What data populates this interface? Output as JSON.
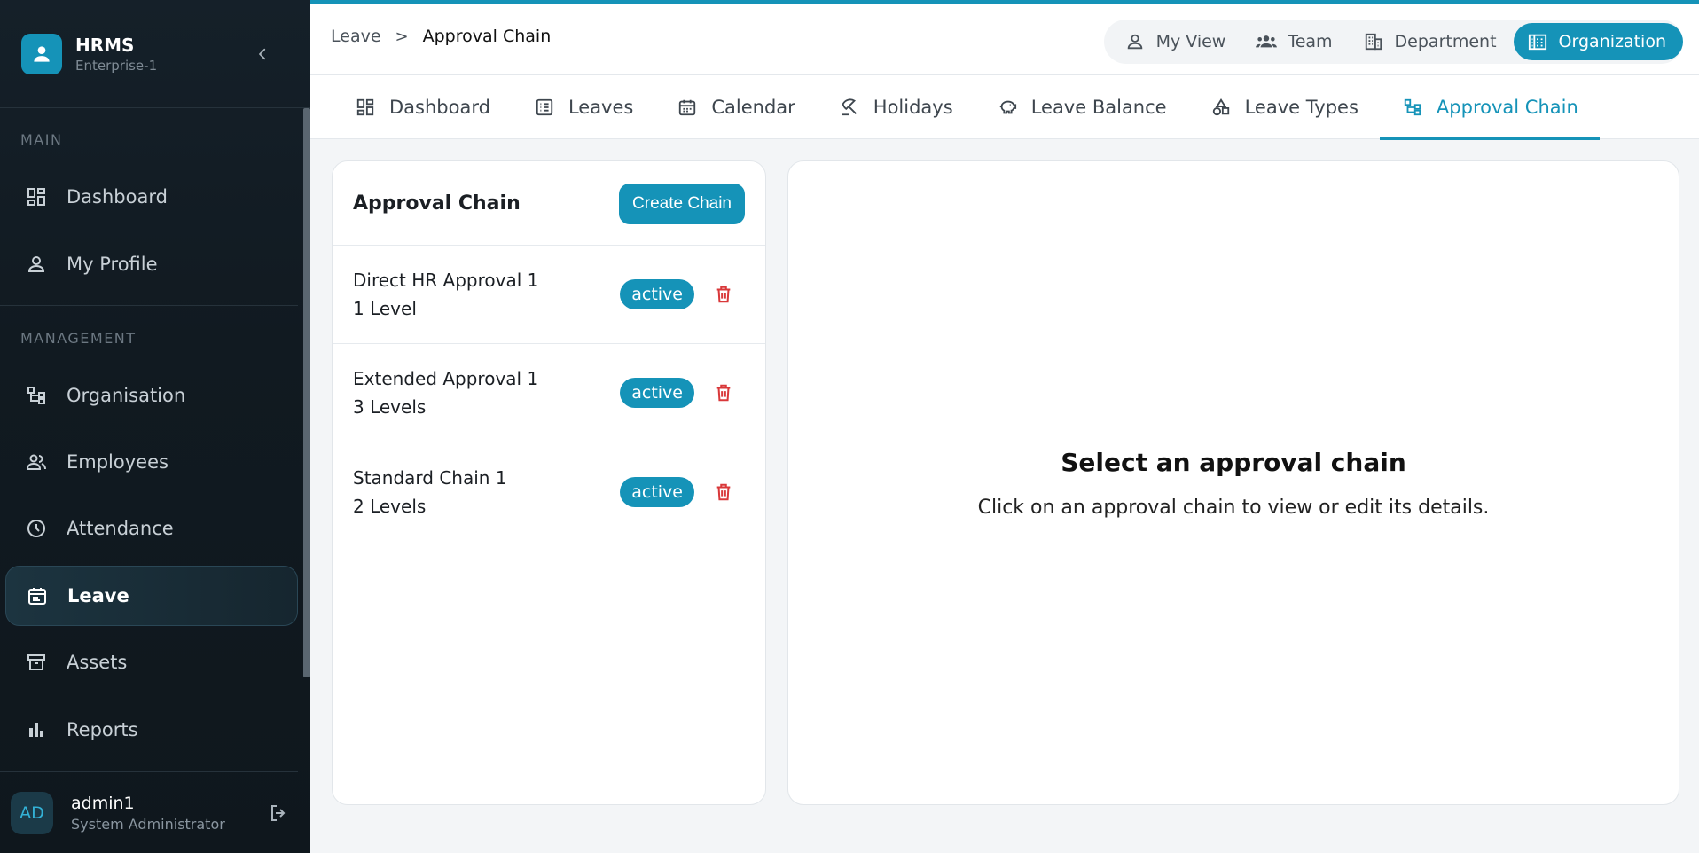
{
  "app": {
    "name": "HRMS",
    "subtitle": "Enterprise-1"
  },
  "sidebar": {
    "sections": [
      {
        "label": "MAIN"
      },
      {
        "label": "MANAGEMENT"
      }
    ],
    "items": [
      {
        "label": "Dashboard",
        "icon": "dashboard-icon"
      },
      {
        "label": "My Profile",
        "icon": "person-icon"
      },
      {
        "label": "Organisation",
        "icon": "org-chart-icon"
      },
      {
        "label": "Employees",
        "icon": "people-icon"
      },
      {
        "label": "Attendance",
        "icon": "clock-icon"
      },
      {
        "label": "Leave",
        "icon": "calendar-icon",
        "active": true
      },
      {
        "label": "Assets",
        "icon": "archive-icon"
      },
      {
        "label": "Reports",
        "icon": "bar-chart-icon"
      }
    ],
    "user": {
      "initials": "AD",
      "name": "admin1",
      "role": "System Administrator"
    }
  },
  "breadcrumb": {
    "parent": "Leave",
    "separator": ">",
    "current": "Approval Chain"
  },
  "views": [
    {
      "label": "My View",
      "icon": "person-icon"
    },
    {
      "label": "Team",
      "icon": "team-icon"
    },
    {
      "label": "Department",
      "icon": "building-icon"
    },
    {
      "label": "Organization",
      "icon": "organization-icon",
      "active": true
    }
  ],
  "tabs": [
    {
      "label": "Dashboard",
      "icon": "dashboard-icon"
    },
    {
      "label": "Leaves",
      "icon": "list-icon"
    },
    {
      "label": "Calendar",
      "icon": "calendar-icon"
    },
    {
      "label": "Holidays",
      "icon": "beach-umbrella-icon"
    },
    {
      "label": "Leave Balance",
      "icon": "piggy-bank-icon"
    },
    {
      "label": "Leave Types",
      "icon": "shapes-icon"
    },
    {
      "label": "Approval Chain",
      "icon": "org-chart-icon",
      "active": true
    }
  ],
  "chain_panel": {
    "title": "Approval Chain",
    "create_label": "Create Chain",
    "chains": [
      {
        "name": "Direct HR Approval 1",
        "levels": "1 Level",
        "status": "active"
      },
      {
        "name": "Extended Approval 1",
        "levels": "3 Levels",
        "status": "active"
      },
      {
        "name": "Standard Chain 1",
        "levels": "2 Levels",
        "status": "active"
      }
    ]
  },
  "detail_panel": {
    "title": "Select an approval chain",
    "subtitle": "Click on an approval chain to view or edit its details."
  },
  "colors": {
    "accent": "#1593b8",
    "danger": "#d9383a",
    "sidebar_bg": "#121b22"
  }
}
